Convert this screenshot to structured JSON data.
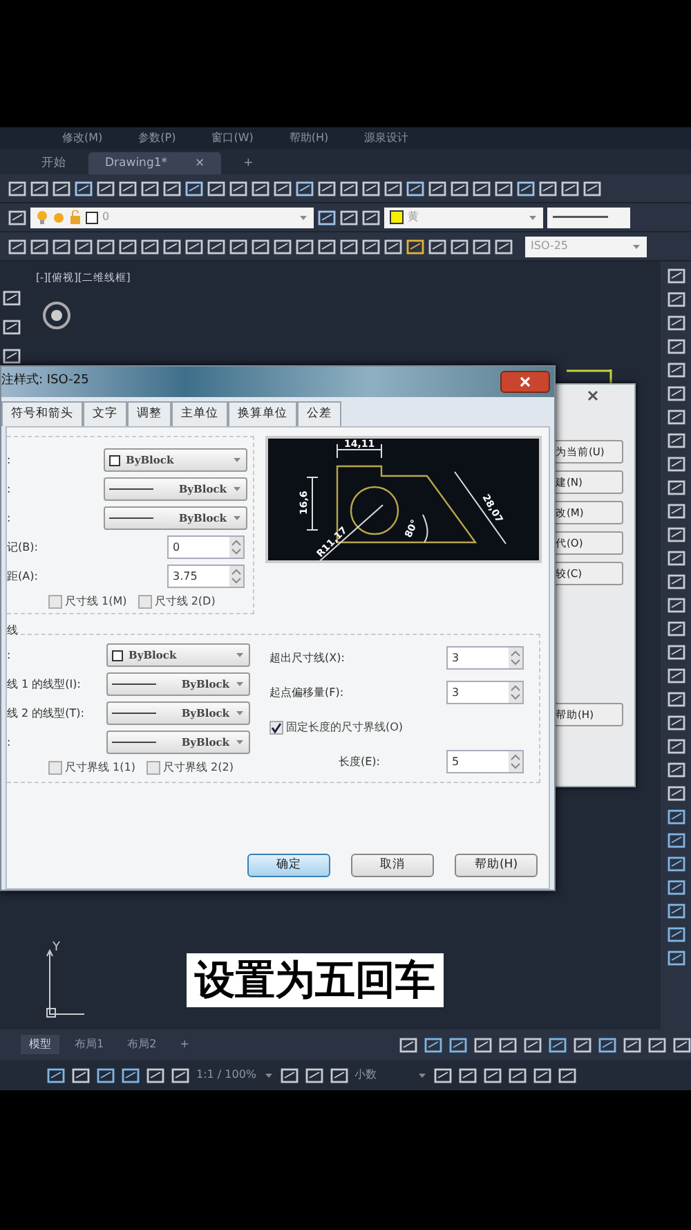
{
  "menu": [
    "修改(M)",
    "参数(P)",
    "窗口(W)",
    "帮助(H)",
    "源泉设计"
  ],
  "tabs": [
    {
      "label": "开始",
      "selected": false
    },
    {
      "label": "Drawing1*",
      "selected": true,
      "close": "×"
    }
  ],
  "new_tab": "+",
  "layer_combo": {
    "value": "0"
  },
  "color_combo": {
    "value": "黄"
  },
  "dimstyle_combo": {
    "value": "ISO-25"
  },
  "viewport_label": "[-][俯视][二维线框]",
  "back_dialog": {
    "buttons": [
      "为当前(U)",
      "建(N)",
      "改(M)",
      "代(O)",
      "较(C)",
      "帮助(H)"
    ]
  },
  "dialog": {
    "title": "注样式: ISO-25",
    "tabs": [
      {
        "label": "符号和箭头",
        "selected": false
      },
      {
        "label": "文字",
        "selected": false
      },
      {
        "label": "调整",
        "selected": false
      },
      {
        "label": "主单位",
        "selected": false
      },
      {
        "label": "换算单位",
        "selected": false
      },
      {
        "label": "公差",
        "selected": false
      }
    ],
    "dim_lines": {
      "rows": [
        {
          "kind": "color",
          "label": ":",
          "value": "ByBlock"
        },
        {
          "kind": "line",
          "label": ":",
          "value": "ByBlock"
        },
        {
          "kind": "line",
          "label": ":",
          "value": "ByBlock"
        },
        {
          "kind": "spin",
          "label": "记(B):",
          "value": "0"
        },
        {
          "kind": "spin",
          "label": "距(A):",
          "value": "3.75"
        }
      ],
      "checks": [
        {
          "label": "尺寸线 1(M)",
          "checked": false
        },
        {
          "label": "尺寸线 2(D)",
          "checked": false
        }
      ]
    },
    "preview": {
      "labels": [
        "14,11",
        "16,6",
        "80°",
        "28,07",
        "R11,17"
      ]
    },
    "ext_lines": {
      "title": "线",
      "rows": [
        {
          "kind": "color",
          "label": ":",
          "value": "ByBlock"
        },
        {
          "kind": "line",
          "label": "线 1 的线型(I):",
          "value": "ByBlock"
        },
        {
          "kind": "line",
          "label": "线 2 的线型(T):",
          "value": "ByBlock"
        },
        {
          "kind": "line",
          "label": ":",
          "value": "ByBlock"
        }
      ],
      "checks": [
        {
          "label": "尺寸界线 1(1)",
          "checked": false
        },
        {
          "label": "尺寸界线 2(2)",
          "checked": false
        }
      ],
      "right": [
        {
          "kind": "spin",
          "label": "超出尺寸线(X):",
          "value": "3"
        },
        {
          "kind": "spin",
          "label": "起点偏移量(F):",
          "value": "3"
        },
        {
          "kind": "check",
          "label": "固定长度的尺寸界线(O)",
          "checked": true
        },
        {
          "kind": "spin",
          "label": "长度(E):",
          "value": "5"
        }
      ]
    },
    "buttons": [
      "确定",
      "取消",
      "帮助(H)"
    ]
  },
  "ucs_label": "Y",
  "caption": "设置为五回车",
  "layout_tabs": [
    {
      "label": "模型",
      "selected": true
    },
    {
      "label": "布局1",
      "selected": false
    },
    {
      "label": "布局2",
      "selected": false
    }
  ],
  "add_layout": "+",
  "status": {
    "scale": "1:1 / 100%",
    "units": "小数"
  }
}
